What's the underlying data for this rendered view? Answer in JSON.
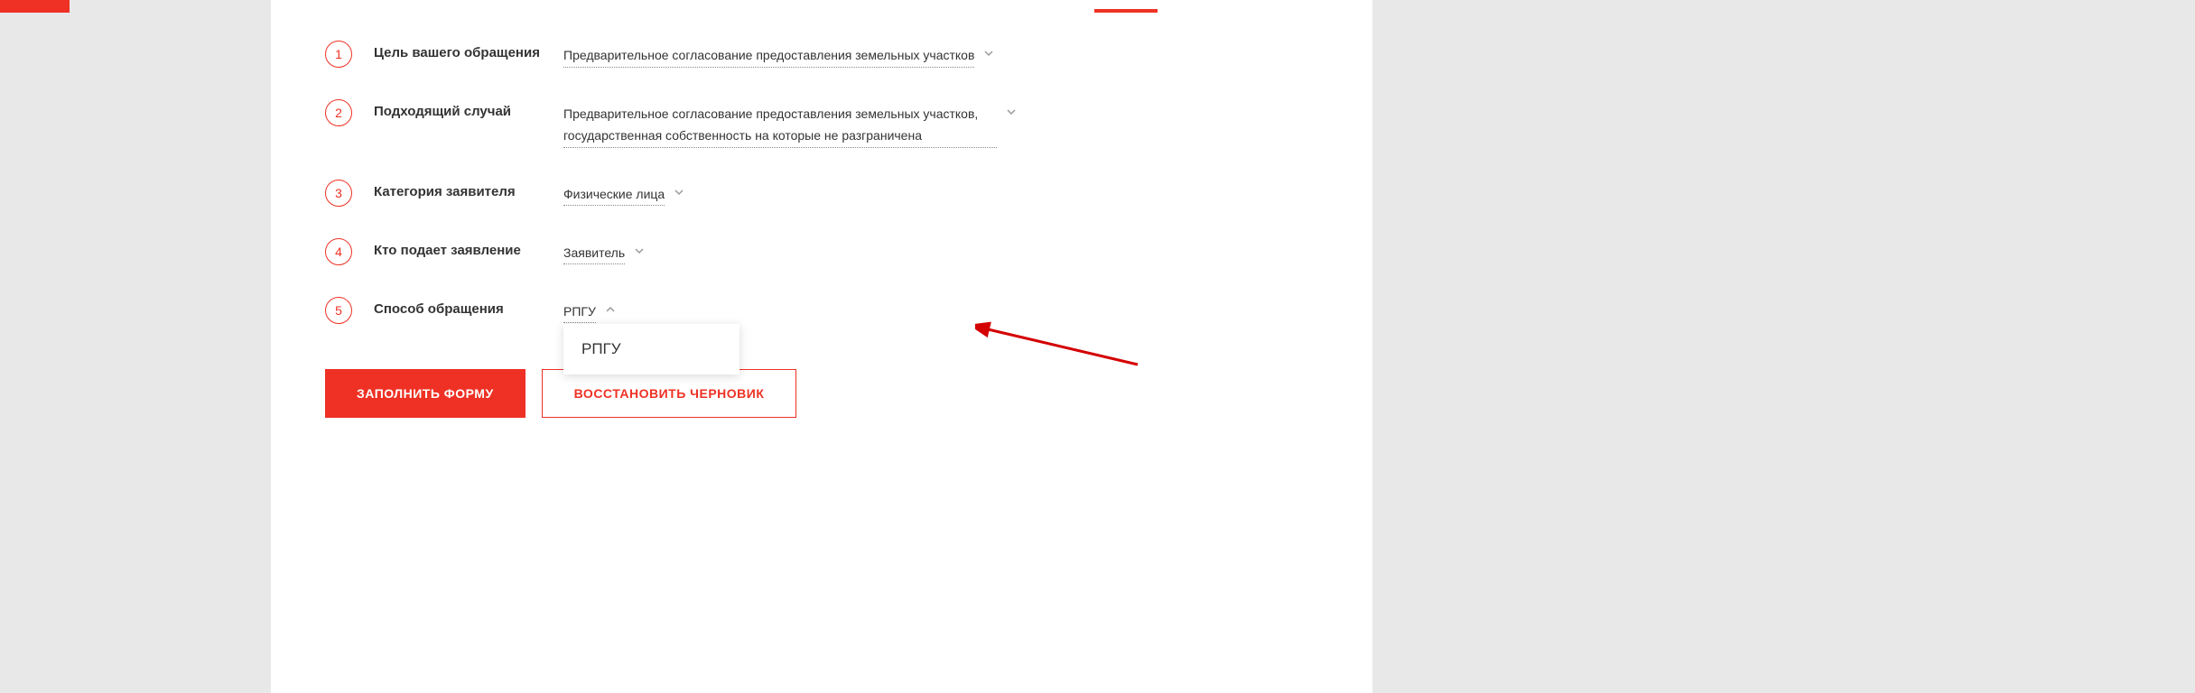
{
  "steps": [
    {
      "num": "1",
      "label": "Цель вашего обращения",
      "value": "Предварительное согласование предоставления земельных участков",
      "open": false
    },
    {
      "num": "2",
      "label": "Подходящий случай",
      "value": "Предварительное согласование предоставления земельных участков, государственная собственность на которые не разграничена",
      "open": false
    },
    {
      "num": "3",
      "label": "Категория заявителя",
      "value": "Физические лица",
      "open": false
    },
    {
      "num": "4",
      "label": "Кто подает заявление",
      "value": "Заявитель",
      "open": false
    },
    {
      "num": "5",
      "label": "Способ обращения",
      "value": "РПГУ",
      "open": true
    }
  ],
  "dropdown": {
    "option1": "РПГУ"
  },
  "buttons": {
    "primary": "ЗАПОЛНИТЬ ФОРМУ",
    "secondary": "ВОССТАНОВИТЬ ЧЕРНОВИК"
  }
}
